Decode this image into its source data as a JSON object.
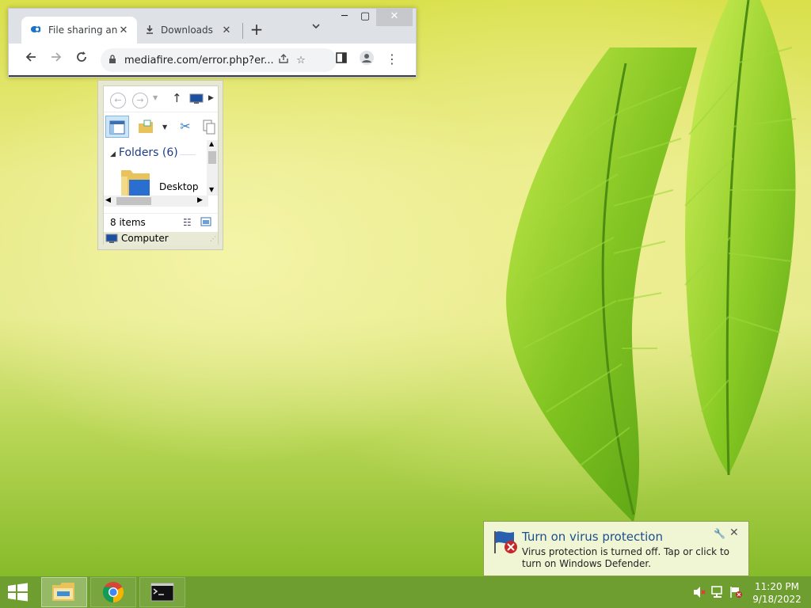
{
  "chrome": {
    "tabs": [
      {
        "title": "File sharing and storage made simple",
        "active": true
      },
      {
        "title": "Downloads",
        "active": false
      }
    ],
    "url": "mediafire.com/error.php?errno=...",
    "url_display": "mediafire.com/error.php?er..."
  },
  "explorer": {
    "group_label": "Folders (6)",
    "folder_name": "Desktop",
    "item_count": "8 items",
    "location": "Computer"
  },
  "toast": {
    "title": "Turn on virus protection",
    "body": "Virus protection is turned off. Tap or click to turn on Windows Defender."
  },
  "taskbar": {
    "apps": [
      {
        "name": "file-explorer",
        "active": true
      },
      {
        "name": "google-chrome",
        "active": false
      },
      {
        "name": "command-prompt",
        "active": false
      }
    ],
    "time": "11:20 PM",
    "date": "9/18/2022"
  },
  "colors": {
    "taskbar": "#6e9e2f",
    "toast_title": "#1c4f8f",
    "explorer_group": "#1e3c87"
  }
}
